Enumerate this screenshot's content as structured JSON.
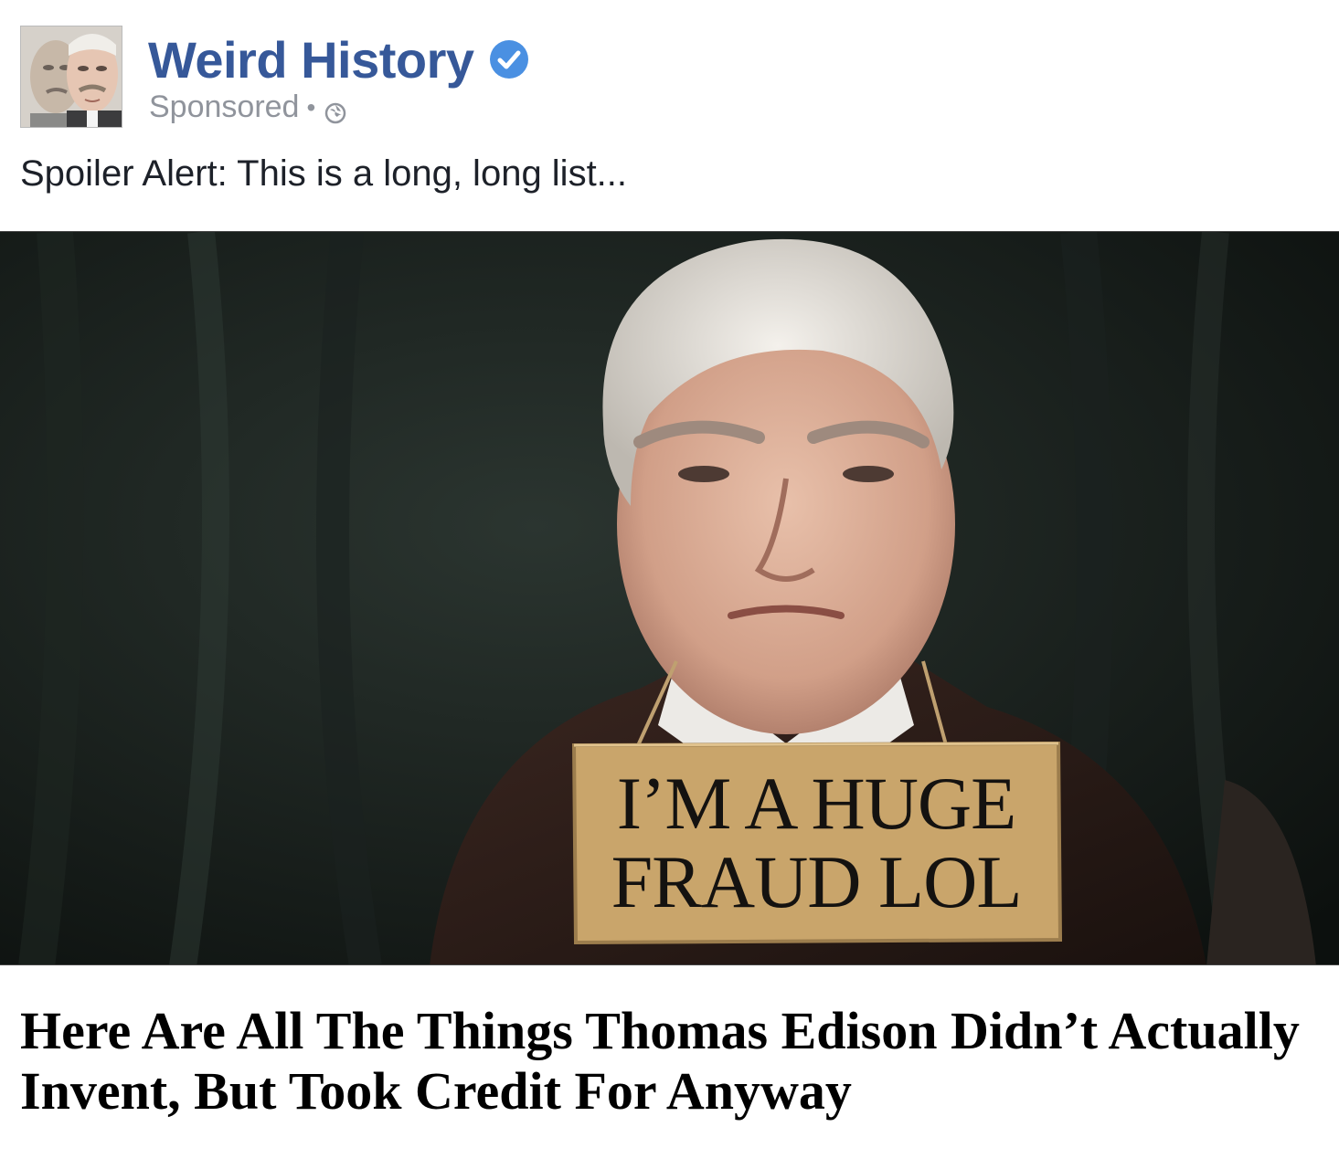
{
  "post": {
    "page_name": "Weird History",
    "verified": true,
    "sponsored_label": "Sponsored",
    "separator": "•",
    "audience_icon": "globe-icon",
    "verified_icon": "verified-checkmark-icon",
    "caption": "Spoiler Alert: This is a long, long list...",
    "image": {
      "sign_line_1": "I’M A HUGE",
      "sign_line_2": "FRAUD LOL"
    },
    "headline": "Here Are All The Things Thomas Edison Didn’t Actually Invent, But Took Credit For Anyway"
  },
  "colors": {
    "page_name": "#365899",
    "verified_badge": "#4a90e2",
    "meta_text": "#90949c",
    "caption_text": "#1d2129",
    "headline_text": "#000000",
    "sign_cardboard": "#c9a56b"
  }
}
